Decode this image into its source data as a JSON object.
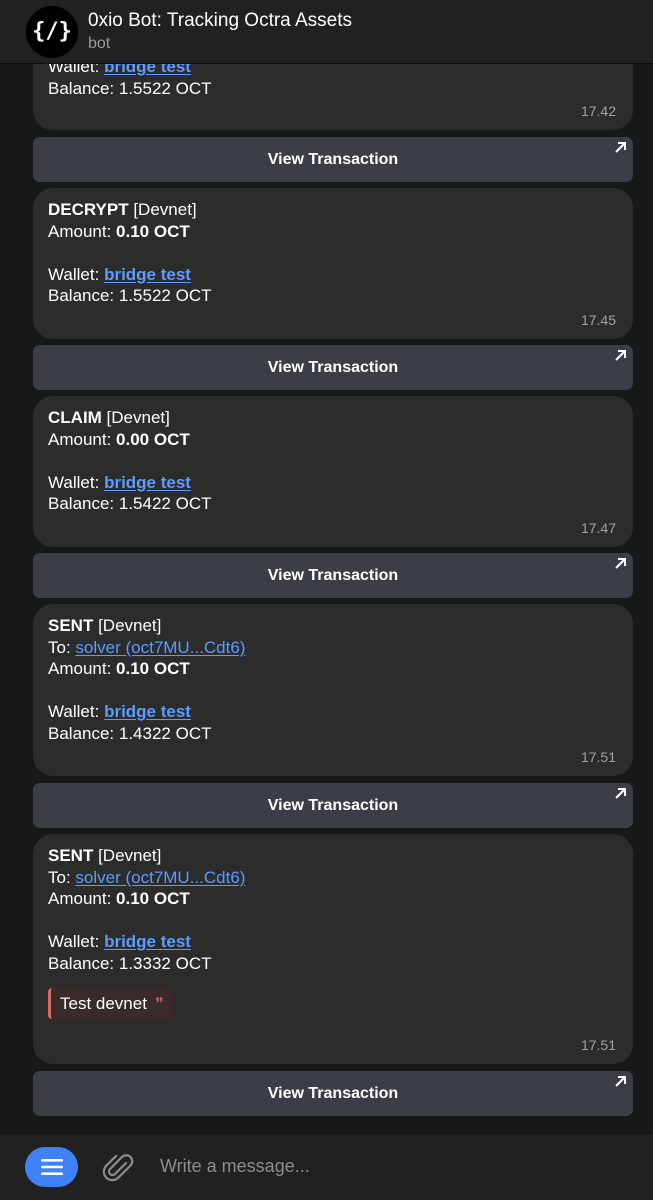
{
  "header": {
    "avatar_text": "{/}",
    "title": "0xio Bot: Tracking Octra Assets",
    "subtitle": "bot"
  },
  "messages": [
    {
      "wallet_label": "Wallet:",
      "wallet_name": "bridge test",
      "balance": "Balance: 1.5522 OCT",
      "time": "17.42"
    },
    {
      "type": "DECRYPT",
      "network": " [Devnet]",
      "amount_label": "Amount: ",
      "amount": "0.10 OCT",
      "wallet_label": "Wallet:",
      "wallet_name": "bridge test",
      "balance": "Balance: 1.5522 OCT",
      "time": "17.45"
    },
    {
      "type": "CLAIM",
      "network": " [Devnet]",
      "amount_label": "Amount: ",
      "amount": "0.00 OCT",
      "wallet_label": "Wallet:",
      "wallet_name": "bridge test",
      "balance": "Balance: 1.5422 OCT",
      "time": "17.47"
    },
    {
      "type": "SENT",
      "network": " [Devnet]",
      "to_label": "To: ",
      "to": "solver (oct7MU...Cdt6)",
      "amount_label": "Amount: ",
      "amount": "0.10 OCT",
      "wallet_label": "Wallet:",
      "wallet_name": "bridge test",
      "balance": "Balance: 1.4322 OCT",
      "time": "17.51"
    },
    {
      "type": "SENT",
      "network": " [Devnet]",
      "to_label": "To: ",
      "to": "solver (oct7MU...Cdt6)",
      "amount_label": "Amount: ",
      "amount": "0.10 OCT",
      "wallet_label": "Wallet:",
      "wallet_name": "bridge test",
      "balance": "Balance: 1.3332 OCT",
      "note": "Test devnet",
      "time": "17.51"
    }
  ],
  "buttons": {
    "view_tx_label": "View Transaction"
  },
  "icons": {
    "quote_mark": "”",
    "external": "external-link-arrow-icon"
  },
  "composer": {
    "placeholder": "Write a message..."
  },
  "colors": {
    "accent": "#3f82f7",
    "link": "#5a9cff",
    "bubble": "#2c2c2c",
    "button": "#3b3f45",
    "quote_bar": "#e06a5f"
  }
}
